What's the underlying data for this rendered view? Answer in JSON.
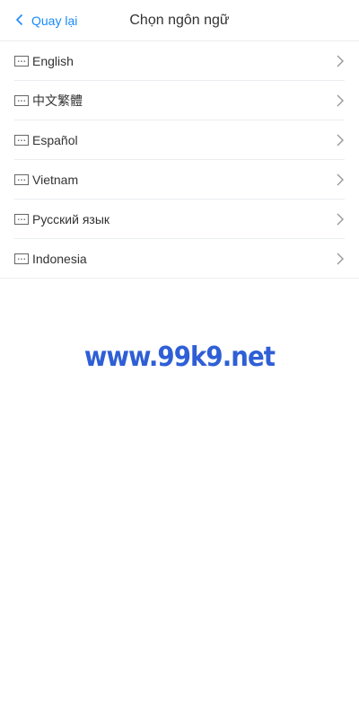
{
  "header": {
    "back_label": "Quay lại",
    "title": "Chọn ngôn ngữ"
  },
  "languages": [
    {
      "label": "English"
    },
    {
      "label": "中文繁體"
    },
    {
      "label": "Español"
    },
    {
      "label": "Vietnam"
    },
    {
      "label": "Русский язык"
    },
    {
      "label": "Indonesia"
    }
  ],
  "watermark": "www.99k9.net",
  "colors": {
    "accent": "#1989fa",
    "watermark": "#2f5fd6"
  },
  "icons": {
    "back": "chevron-left-icon",
    "item": "keyboard-icon",
    "arrow": "chevron-right-icon"
  }
}
